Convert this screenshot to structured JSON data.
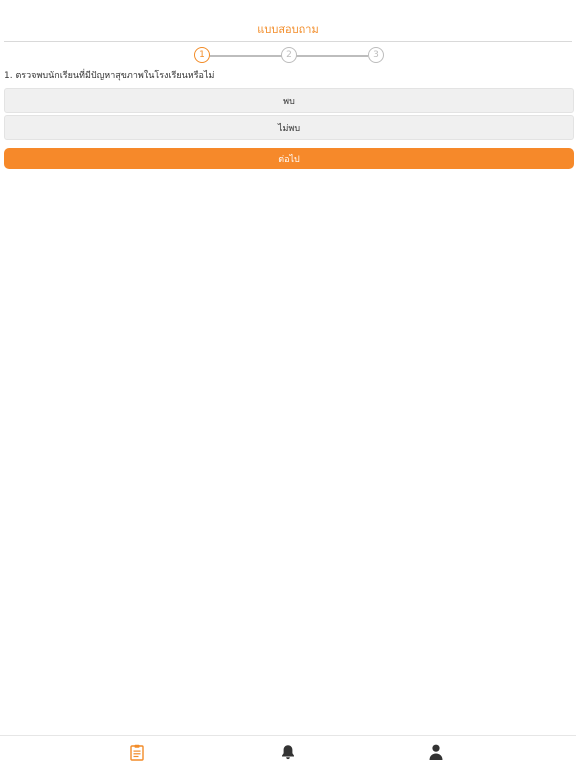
{
  "header": {
    "title": "แบบสอบถาม"
  },
  "stepper": {
    "steps": [
      "1",
      "2",
      "3"
    ],
    "current": 1,
    "active_color": "#f28c28",
    "inactive_color": "#bdbdbd"
  },
  "question": {
    "text": "1. ตรวจพบนักเรียนที่มีปัญหาสุขภาพในโรงเรียนหรือไม่"
  },
  "options": [
    {
      "label": "พบ"
    },
    {
      "label": "ไม่พบ"
    }
  ],
  "next_button": {
    "label": "ต่อไป",
    "color": "#f6892a"
  },
  "bottom_nav": {
    "items": [
      {
        "icon": "clipboard-icon",
        "active": true
      },
      {
        "icon": "bell-icon",
        "active": false
      },
      {
        "icon": "user-icon",
        "active": false
      }
    ]
  }
}
